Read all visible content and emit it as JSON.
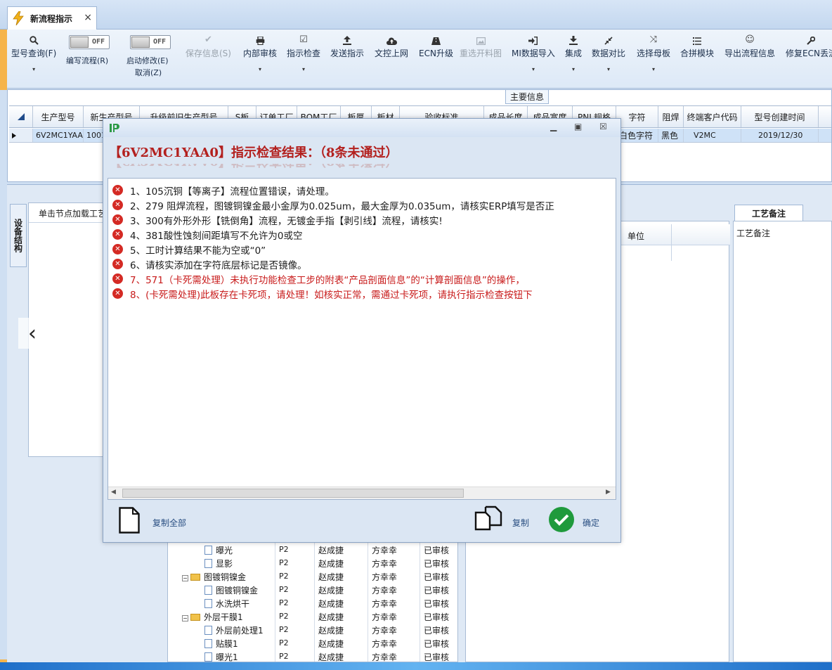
{
  "tab": {
    "title": "新流程指示",
    "close": "×"
  },
  "toolbar": {
    "query": "型号查询(F)",
    "edit_flow": "编写流程(R)",
    "edit_flow_toggle": "OFF",
    "start_modify": "启动修改(E)",
    "start_modify_toggle": "OFF",
    "cancel": "取消(Z)",
    "save_info": "保存信息(S)",
    "internal_review": "内部审核",
    "instruction_check": "指示检查",
    "send_instruction": "发送指示",
    "doc_upload": "文控上网",
    "ecn_upgrade": "ECN升级",
    "reselect_chart": "重选开料图",
    "mi_import": "MI数据导入",
    "integrate": "集成",
    "data_compare": "数据对比",
    "select_motherboard": "选择母板",
    "merge_module": "合拼模块",
    "export_flow": "导出流程信息",
    "repair_ecn": "修复ECN丢流"
  },
  "main_info": {
    "title": "主要信息",
    "columns": [
      "生产型号",
      "新生产型号",
      "升级前旧生产型号",
      "S板",
      "订单工厂",
      "BOM工厂",
      "板厚",
      "板材",
      "验收标准",
      "成品长度",
      "成品宽度",
      "PNL规格",
      "字符",
      "阻焊",
      "终端客户代码",
      "型号创建时间"
    ],
    "row": [
      "6V2MC1YAA0",
      "10010",
      "",
      "",
      "",
      "",
      "",
      "",
      "",
      "",
      "",
      "",
      "白色字符",
      "黑色",
      "V2MC",
      "2019/12/30"
    ]
  },
  "lower": {
    "vertical_tab": "设备结构",
    "left_header": "单击节点加载工艺",
    "mid_unit": "单位",
    "right_tab": "工艺备注",
    "right_label": "工艺备注"
  },
  "tree": [
    {
      "name": "曝光",
      "c1": "P2",
      "c2": "赵成捷",
      "c3": "方幸幸",
      "c4": "已审核",
      "type": "file",
      "partial": true
    },
    {
      "name": "曝光",
      "c1": "P2",
      "c2": "赵成捷",
      "c3": "方幸幸",
      "c4": "已审核",
      "type": "file"
    },
    {
      "name": "显影",
      "c1": "P2",
      "c2": "赵成捷",
      "c3": "方幸幸",
      "c4": "已审核",
      "type": "file"
    },
    {
      "name": "图镀铜镍金",
      "c1": "P2",
      "c2": "赵成捷",
      "c3": "方幸幸",
      "c4": "已审核",
      "type": "folder"
    },
    {
      "name": "图镀铜镍金",
      "c1": "P2",
      "c2": "赵成捷",
      "c3": "方幸幸",
      "c4": "已审核",
      "type": "file"
    },
    {
      "name": "水洗烘干",
      "c1": "P2",
      "c2": "赵成捷",
      "c3": "方幸幸",
      "c4": "已审核",
      "type": "file"
    },
    {
      "name": "外层干膜1",
      "c1": "P2",
      "c2": "赵成捷",
      "c3": "方幸幸",
      "c4": "已审核",
      "type": "folder"
    },
    {
      "name": "外层前处理1",
      "c1": "P2",
      "c2": "赵成捷",
      "c3": "方幸幸",
      "c4": "已审核",
      "type": "file"
    },
    {
      "name": "贴膜1",
      "c1": "P2",
      "c2": "赵成捷",
      "c3": "方幸幸",
      "c4": "已审核",
      "type": "file"
    },
    {
      "name": "曝光1",
      "c1": "P2",
      "c2": "赵成捷",
      "c3": "方幸幸",
      "c4": "已审核",
      "type": "file"
    }
  ],
  "dialog": {
    "title": "【6V2MC1YAA0】指示检查结果：（8条未通过）",
    "messages": [
      {
        "text": "1、105沉铜【等离子】流程位置错误，请处理。",
        "red": false
      },
      {
        "text": "2、279 阻焊流程，图镀铜镍金最小金厚为0.025um，最大金厚为0.035um，请核实ERP填写是否正",
        "red": false
      },
      {
        "text": "3、300有外形外形【铣倒角】流程，无镀金手指【剥引线】流程，请核实!",
        "red": false
      },
      {
        "text": "4、381酸性蚀刻间距填写不允许为0或空",
        "red": false
      },
      {
        "text": "5、工时计算结果不能为空或“0”",
        "red": false
      },
      {
        "text": "6、请核实添加在字符底层标记是否镜像。",
        "red": false
      },
      {
        "text": "7、571（卡死需处理）未执行功能检查工步的附表“产品剖面信息”的“计算剖面信息”的操作，",
        "red": true
      },
      {
        "text": "8、(卡死需处理)此板存在卡死项，请处理！如核实正常，需通过卡死项，请执行指示检查按钮下",
        "red": true
      }
    ],
    "copy_all": "复制全部",
    "copy": "复制",
    "ok": "确定"
  }
}
